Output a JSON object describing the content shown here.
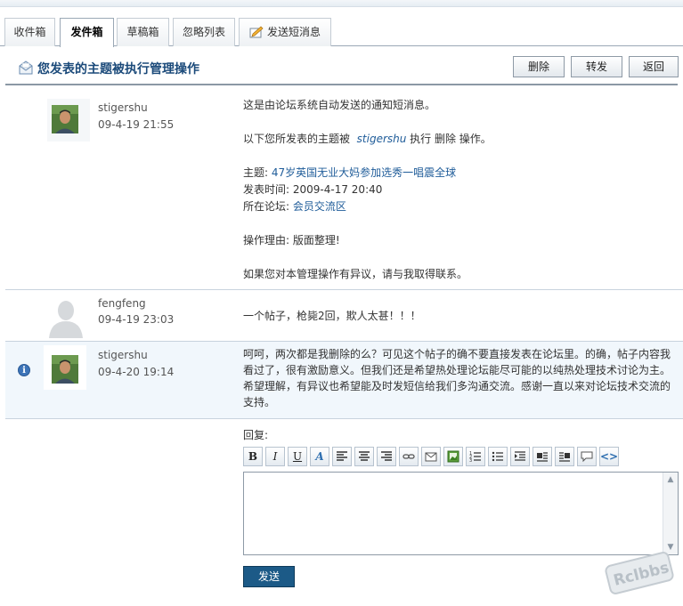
{
  "tabs": [
    {
      "label": "收件箱",
      "active": false
    },
    {
      "label": "发件箱",
      "active": true
    },
    {
      "label": "草稿箱",
      "active": false
    },
    {
      "label": "忽略列表",
      "active": false
    },
    {
      "label": "发送短消息",
      "active": false,
      "icon": "compose-icon"
    }
  ],
  "header": {
    "title": "您发表的主题被执行管理操作",
    "icon": "envelope-icon",
    "buttons": {
      "delete": "删除",
      "forward": "转发",
      "back": "返回"
    }
  },
  "messages": [
    {
      "user": "stigershu",
      "time": "09-4-19 21:55",
      "avatar": "user-photo",
      "lines": {
        "intro": "这是由论坛系统自动发送的通知短消息。",
        "op_prefix": "以下您所发表的主题被",
        "op_user": "stigershu",
        "op_suffix": "执行 删除 操作。",
        "topic_label": "主题:",
        "topic_link": "47岁英国无业大妈参加选秀一唱震全球",
        "posted_label": "发表时间:",
        "posted_value": "2009-4-17 20:40",
        "forum_label": "所在论坛:",
        "forum_link": "会员交流区",
        "reason": "操作理由: 版面整理!",
        "contact": "如果您对本管理操作有异议，请与我取得联系。"
      }
    },
    {
      "user": "fengfeng",
      "time": "09-4-19 23:03",
      "avatar": "default-avatar",
      "text": "一个帖子，枪毙2回，欺人太甚！！！"
    },
    {
      "user": "stigershu",
      "time": "09-4-20 19:14",
      "avatar": "user-photo",
      "status_icon": "info-icon",
      "text": "呵呵，两次都是我删除的么？可见这个帖子的确不要直接发表在论坛里。的确，帖子内容我看过了，很有激励意义。但我们还是希望热处理论坛能尽可能的以纯热处理技术讨论为主。希望理解，有异议也希望能及时发短信给我们多沟通交流。感谢一直以来对论坛技术交流的支持。"
    }
  ],
  "reply": {
    "label": "回复:",
    "toolbar": [
      "bold",
      "italic",
      "underline",
      "font-color",
      "align-left",
      "align-center",
      "align-right",
      "link",
      "email",
      "image",
      "ordered-list",
      "unordered-list",
      "indent",
      "float-left",
      "float-right",
      "quote",
      "code"
    ],
    "value": "",
    "send_label": "发送"
  },
  "watermark": "Rclbbs",
  "colors": {
    "accent": "#1c5a87",
    "title": "#1b4a7a",
    "link": "#1f5c99",
    "highlight_row": "#f1f7fc"
  }
}
